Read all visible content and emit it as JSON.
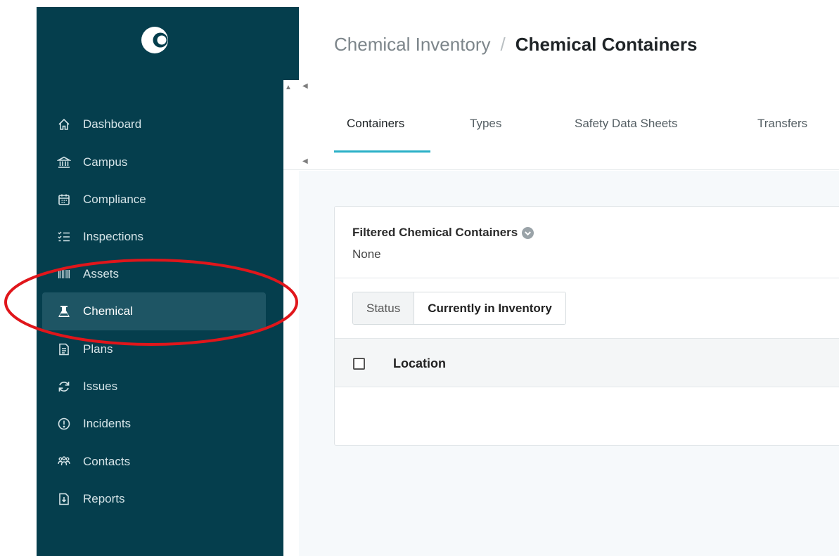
{
  "sidebar": {
    "items": [
      {
        "label": "Dashboard",
        "icon": "home-icon"
      },
      {
        "label": "Campus",
        "icon": "building-columns-icon"
      },
      {
        "label": "Compliance",
        "icon": "calendar-icon"
      },
      {
        "label": "Inspections",
        "icon": "checklist-icon"
      },
      {
        "label": "Assets",
        "icon": "barcode-icon"
      },
      {
        "label": "Chemical",
        "icon": "flask-icon",
        "active": true
      },
      {
        "label": "Plans",
        "icon": "document-icon"
      },
      {
        "label": "Issues",
        "icon": "refresh-icon"
      },
      {
        "label": "Incidents",
        "icon": "alert-circle-icon"
      },
      {
        "label": "Contacts",
        "icon": "people-icon"
      },
      {
        "label": "Reports",
        "icon": "report-download-icon"
      }
    ]
  },
  "header": {
    "breadcrumb_parent": "Chemical Inventory",
    "breadcrumb_separator": "/",
    "breadcrumb_current": "Chemical Containers"
  },
  "tabs": [
    {
      "label": "Containers",
      "active": true
    },
    {
      "label": "Types"
    },
    {
      "label": "Safety Data Sheets"
    },
    {
      "label": "Transfers"
    }
  ],
  "filter": {
    "title": "Filtered Chemical Containers",
    "value": "None",
    "chip_label": "Status",
    "chip_value": "Currently in Inventory"
  },
  "table": {
    "columns": [
      "Location"
    ]
  },
  "colors": {
    "sidebar_bg": "#053e4d",
    "active_item_bg": "#1e5564",
    "tab_accent": "#2ab0c7",
    "annotation_red": "#e0161b"
  }
}
